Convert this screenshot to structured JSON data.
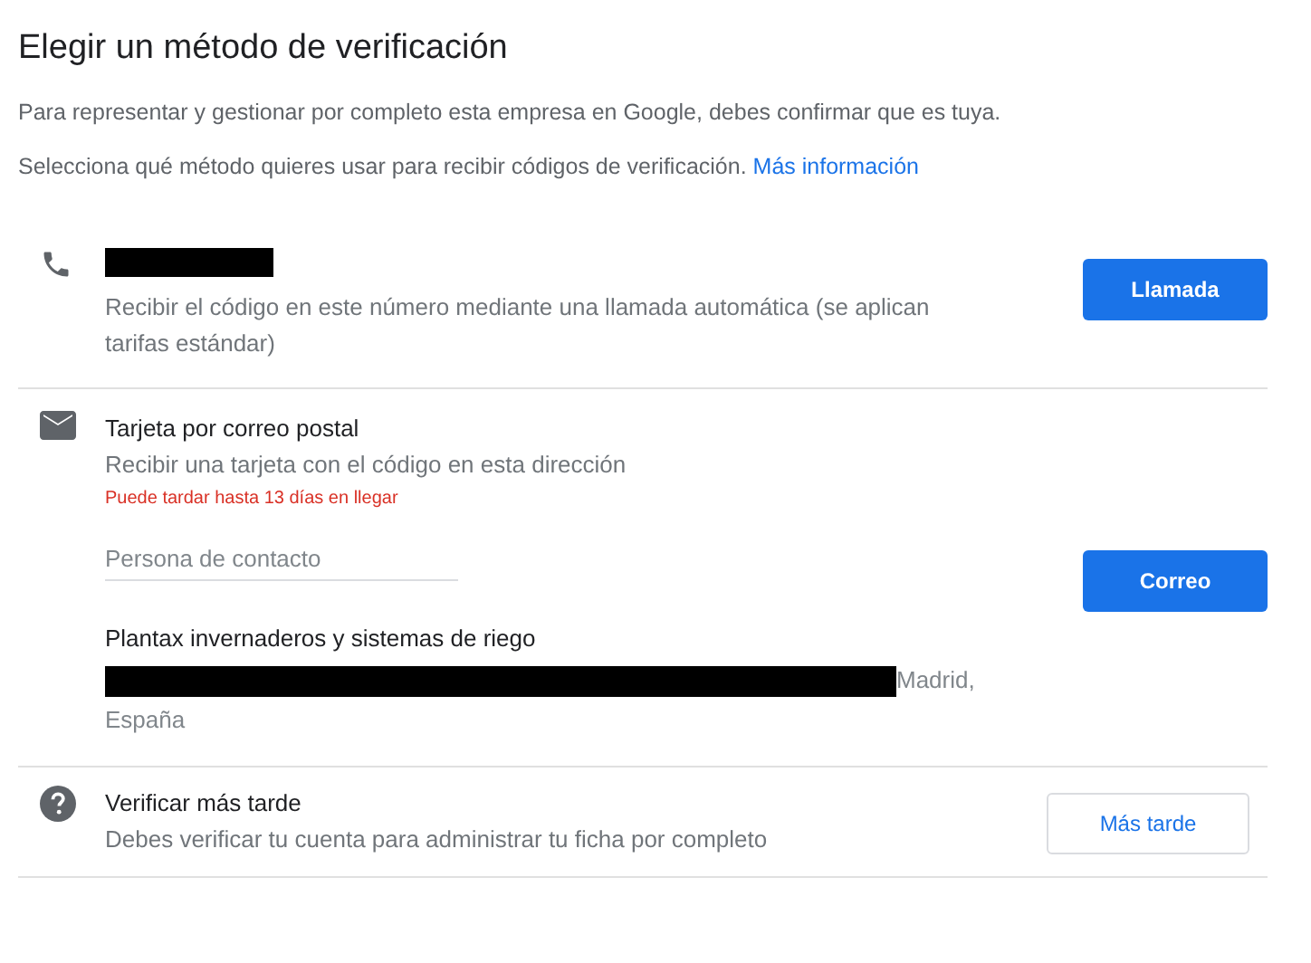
{
  "title": "Elegir un método de verificación",
  "intro": [
    "Para representar y gestionar por completo esta empresa en Google, debes confirmar que es tuya.",
    "Selecciona qué método quieres usar para recibir códigos de verificación."
  ],
  "more_info_link": "Más información",
  "methods": [
    {
      "kind": "phone",
      "title_redacted": true,
      "description": "Recibir el código en este número mediante una llamada automática (se aplican tarifas estándar)",
      "button": {
        "label": "Llamada"
      }
    },
    {
      "kind": "mail",
      "title": "Tarjeta por correo postal",
      "description": "Recibir una tarjeta con el código en esta dirección",
      "warning": "Puede tardar hasta 13 días en llegar",
      "contact_field": {
        "placeholder": "Persona de contacto"
      },
      "business_name": "Plantax invernaderos y sistemas de riego",
      "address_redacted": true,
      "address": "Madrid, España",
      "button": {
        "label": "Correo"
      }
    },
    {
      "kind": "later",
      "title": "Verificar más tarde",
      "description": "Debes verificar tu cuenta para administrar tu ficha por completo",
      "button": {
        "label": "Más tarde"
      }
    }
  ]
}
